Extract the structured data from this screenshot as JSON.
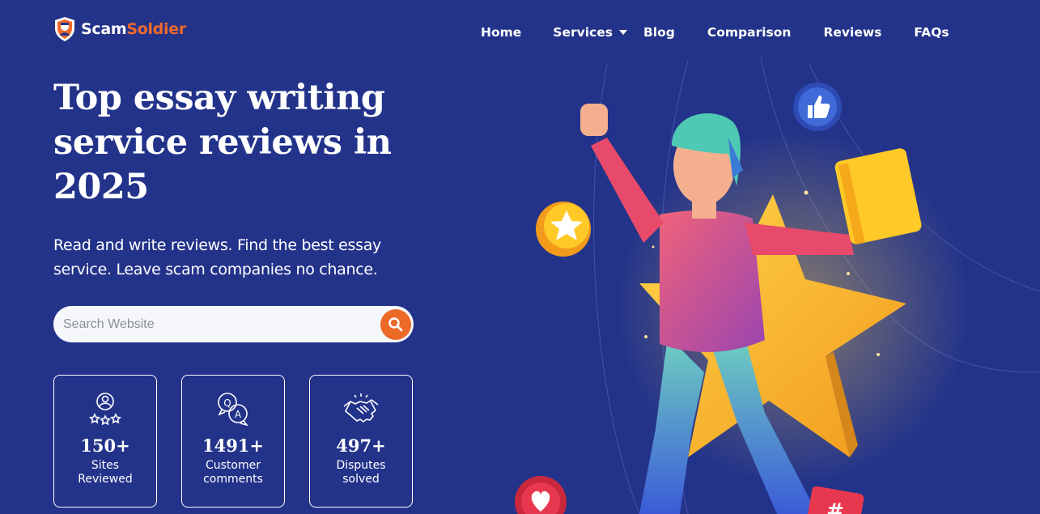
{
  "brand": {
    "part1": "Scam",
    "part2": "Soldier"
  },
  "nav": {
    "home": "Home",
    "services": "Services",
    "blog": "Blog",
    "comparison": "Comparison",
    "reviews": "Reviews",
    "faqs": "FAQs"
  },
  "hero": {
    "title": "Top essay writing service reviews in 2025",
    "subtitle": "Read and write reviews. Find the best essay service. Leave scam companies no chance."
  },
  "search": {
    "placeholder": "Search Website",
    "value": ""
  },
  "stats": [
    {
      "number": "150+",
      "label_line1": "Sites",
      "label_line2": "Reviewed",
      "icon": "user-stars-icon"
    },
    {
      "number": "1491+",
      "label_line1": "Customer",
      "label_line2": "comments",
      "icon": "qa-bubbles-icon"
    },
    {
      "number": "497+",
      "label_line1": "Disputes",
      "label_line2": "solved",
      "icon": "handshake-icon"
    }
  ],
  "colors": {
    "background": "#23338a",
    "accent": "#ec6a27",
    "text": "#ffffff"
  }
}
